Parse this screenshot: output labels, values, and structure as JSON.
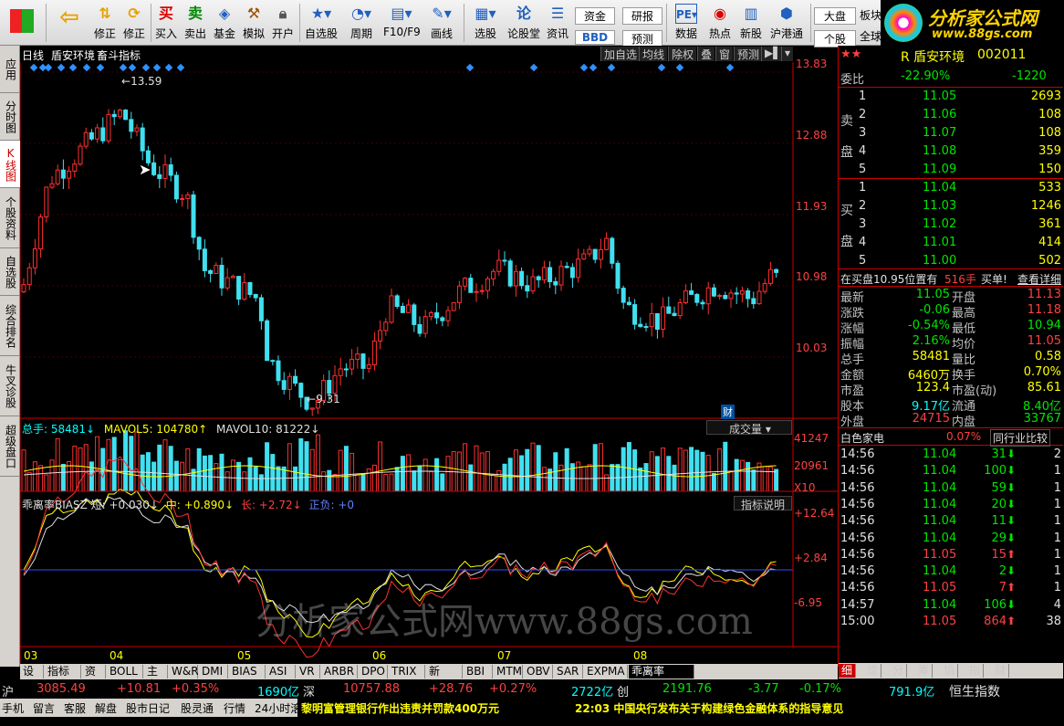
{
  "toolbar": {
    "items": [
      {
        "label": "",
        "icon": "windows-icon"
      },
      {
        "label": "",
        "icon": "back-arrow-icon"
      },
      {
        "label": "修正",
        "icon": "up-down-arrows-icon"
      },
      {
        "label": "修正",
        "icon": "refresh-icon"
      },
      {
        "label": "买入",
        "icon": "buy-icon"
      },
      {
        "label": "卖出",
        "icon": "sell-icon"
      },
      {
        "label": "基金",
        "icon": "fund-icon"
      },
      {
        "label": "模拟",
        "icon": "hammer-icon"
      },
      {
        "label": "开户",
        "icon": "lock-icon"
      },
      {
        "label": "自选股",
        "icon": "star-icon"
      },
      {
        "label": "周期",
        "icon": "clock-icon"
      },
      {
        "label": "F10/F9",
        "icon": "f10-icon"
      },
      {
        "label": "画线",
        "icon": "pencil-icon"
      },
      {
        "label": "选股",
        "icon": "select-stock-icon"
      },
      {
        "label": "论股堂",
        "icon": "discuss-icon"
      },
      {
        "label": "资讯",
        "icon": "news-icon"
      },
      {
        "label": "资金",
        "icon": ""
      },
      {
        "label": "BBD",
        "icon": ""
      },
      {
        "label": "研报",
        "icon": ""
      },
      {
        "label": "预测",
        "icon": ""
      },
      {
        "label": "数据",
        "icon": "pe-icon"
      },
      {
        "label": "热点",
        "icon": "hot-icon"
      },
      {
        "label": "新股",
        "icon": "new-stock-icon"
      },
      {
        "label": "沪港通",
        "icon": "shhk-icon"
      },
      {
        "label": "大盘",
        "icon": ""
      },
      {
        "label": "个股",
        "icon": ""
      },
      {
        "label": "板块",
        "icon": ""
      },
      {
        "label": "全球",
        "icon": ""
      }
    ]
  },
  "logo": {
    "title": "分析家公式网",
    "url": "www.88gs.com"
  },
  "vtabs": [
    "应用",
    "分时图",
    "K线图",
    "个股资料",
    "自选股",
    "综合排名",
    "牛叉诊股",
    "超级盘口"
  ],
  "chart_header": {
    "period": "日线",
    "name": "盾安环境",
    "indicator": "畜斗指标",
    "buttons": [
      "加自选",
      "均线",
      "除权",
      "叠",
      "窗",
      "预测"
    ]
  },
  "price_axis": {
    "labels": [
      "13.83",
      "12.88",
      "11.93",
      "10.98",
      "10.03"
    ]
  },
  "annotations": {
    "high": "13.59",
    "low": "9.31",
    "cai": "财"
  },
  "volume": {
    "title": "总手: 58481↓",
    "mavol5": "MAVOL5: 104780↑",
    "mavol10": "MAVOL10: 81222↓",
    "dropdown": "成交量",
    "axis": [
      "41247",
      "20961",
      "X10"
    ]
  },
  "bias": {
    "title": "乖离率BIASZ 短: +0.030↓",
    "mid": "中: +0.890↓",
    "long": "长: +2.72↓",
    "zf": "正负: +0",
    "button": "指标说明",
    "axis": [
      "+12.64",
      "+2.84",
      "-6.95"
    ]
  },
  "months": [
    "03",
    "04",
    "05",
    "06",
    "07",
    "08"
  ],
  "bottom_tabs": [
    "设置",
    "指标平台",
    "资讯",
    "BOLL",
    "主力",
    "W&R",
    "DMI",
    "BIAS",
    "ASI",
    "VR",
    "ARBR",
    "DPO",
    "TRIX",
    "新DMA",
    "BBI",
    "MTM",
    "OBV",
    "SAR",
    "EXPMA",
    "乖离率BIASZ"
  ],
  "right_tabs": [
    "细",
    "诊",
    "分",
    "筹",
    "馅",
    "指",
    "财"
  ],
  "stock": {
    "code": "002011",
    "name": "R 盾安环境",
    "weibi_label": "委比",
    "weibi": "-22.90%",
    "weicha": "-1220",
    "sell_label": "卖盘",
    "buy_label": "买盘",
    "sells": [
      {
        "n": "5",
        "p": "11.09",
        "v": "150"
      },
      {
        "n": "4",
        "p": "11.08",
        "v": "359"
      },
      {
        "n": "3",
        "p": "11.07",
        "v": "108"
      },
      {
        "n": "2",
        "p": "11.06",
        "v": "108"
      },
      {
        "n": "1",
        "p": "11.05",
        "v": "2693"
      }
    ],
    "buys": [
      {
        "n": "1",
        "p": "11.04",
        "v": "533"
      },
      {
        "n": "2",
        "p": "11.03",
        "v": "1246"
      },
      {
        "n": "3",
        "p": "11.02",
        "v": "361"
      },
      {
        "n": "4",
        "p": "11.01",
        "v": "414"
      },
      {
        "n": "5",
        "p": "11.00",
        "v": "502"
      }
    ],
    "notice": "在买盘10.95位置有",
    "notice_num": "516手",
    "notice_act": "买单!",
    "notice_btn": "查看详细",
    "stats": [
      {
        "l1": "最新",
        "v1": "11.05",
        "l2": "开盘",
        "v2": "11.13"
      },
      {
        "l1": "涨跌",
        "v1": "-0.06",
        "l2": "最高",
        "v2": "11.18"
      },
      {
        "l1": "涨幅",
        "v1": "-0.54%",
        "l2": "最低",
        "v2": "10.94"
      },
      {
        "l1": "振幅",
        "v1": "2.16%",
        "l2": "均价",
        "v2": "11.05"
      },
      {
        "l1": "总手",
        "v1": "58481",
        "l2": "量比",
        "v2": "0.58"
      },
      {
        "l1": "金额",
        "v1": "6460万",
        "l2": "换手",
        "v2": "0.70%"
      },
      {
        "l1": "市盈",
        "v1": "123.4",
        "l2": "市盈(动)",
        "v2": "85.61"
      },
      {
        "l1": "股本",
        "v1": "9.17亿",
        "l2": "流通",
        "v2": "8.40亿"
      },
      {
        "l1": "外盘",
        "v1": "24715",
        "l2": "内盘",
        "v2": "33767"
      }
    ],
    "sector": "白色家电",
    "sector_pct": "0.07%",
    "sector_btn": "同行业比较",
    "ticks": [
      {
        "t": "14:56",
        "p": "11.04",
        "v": "31",
        "d": "down",
        "x": "2"
      },
      {
        "t": "14:56",
        "p": "11.04",
        "v": "100",
        "d": "down",
        "x": "1"
      },
      {
        "t": "14:56",
        "p": "11.04",
        "v": "59",
        "d": "down",
        "x": "1"
      },
      {
        "t": "14:56",
        "p": "11.04",
        "v": "20",
        "d": "down",
        "x": "1"
      },
      {
        "t": "14:56",
        "p": "11.04",
        "v": "11",
        "d": "down",
        "x": "1"
      },
      {
        "t": "14:56",
        "p": "11.04",
        "v": "29",
        "d": "down",
        "x": "1"
      },
      {
        "t": "14:56",
        "p": "11.05",
        "v": "15",
        "d": "up",
        "x": "1"
      },
      {
        "t": "14:56",
        "p": "11.04",
        "v": "2",
        "d": "down",
        "x": "1"
      },
      {
        "t": "14:56",
        "p": "11.05",
        "v": "7",
        "d": "up",
        "x": "1"
      },
      {
        "t": "14:57",
        "p": "11.04",
        "v": "106",
        "d": "down",
        "x": "4"
      },
      {
        "t": "15:00",
        "p": "11.05",
        "v": "864",
        "d": "up",
        "x": "38"
      }
    ]
  },
  "status": {
    "sh": "沪",
    "sh_idx": "3085.49",
    "sh_chg": "+10.81",
    "sh_pct": "+0.35%",
    "sh_amt": "1690亿",
    "sz": "深",
    "sz_idx": "10757.88",
    "sz_chg": "+28.76",
    "sz_pct": "+0.27%",
    "sz_amt": "2722亿",
    "cy": "创",
    "cy_idx": "2191.76",
    "cy_chg": "-3.77",
    "cy_pct": "-0.17%",
    "hk_amt": "791.9亿",
    "hk": "恒生指数"
  },
  "status2": {
    "items": [
      "手机",
      "留言",
      "客服",
      "解盘",
      "股市日记",
      "股灵通",
      "行情",
      "24小时滚动"
    ],
    "news1": "黎明富管理银行作出违责并罚款400万元",
    "news2": "22:03 中国央行发布关于构建绿色金融体系的指导意见"
  },
  "watermark": "分析家公式网www.88gs.com"
}
